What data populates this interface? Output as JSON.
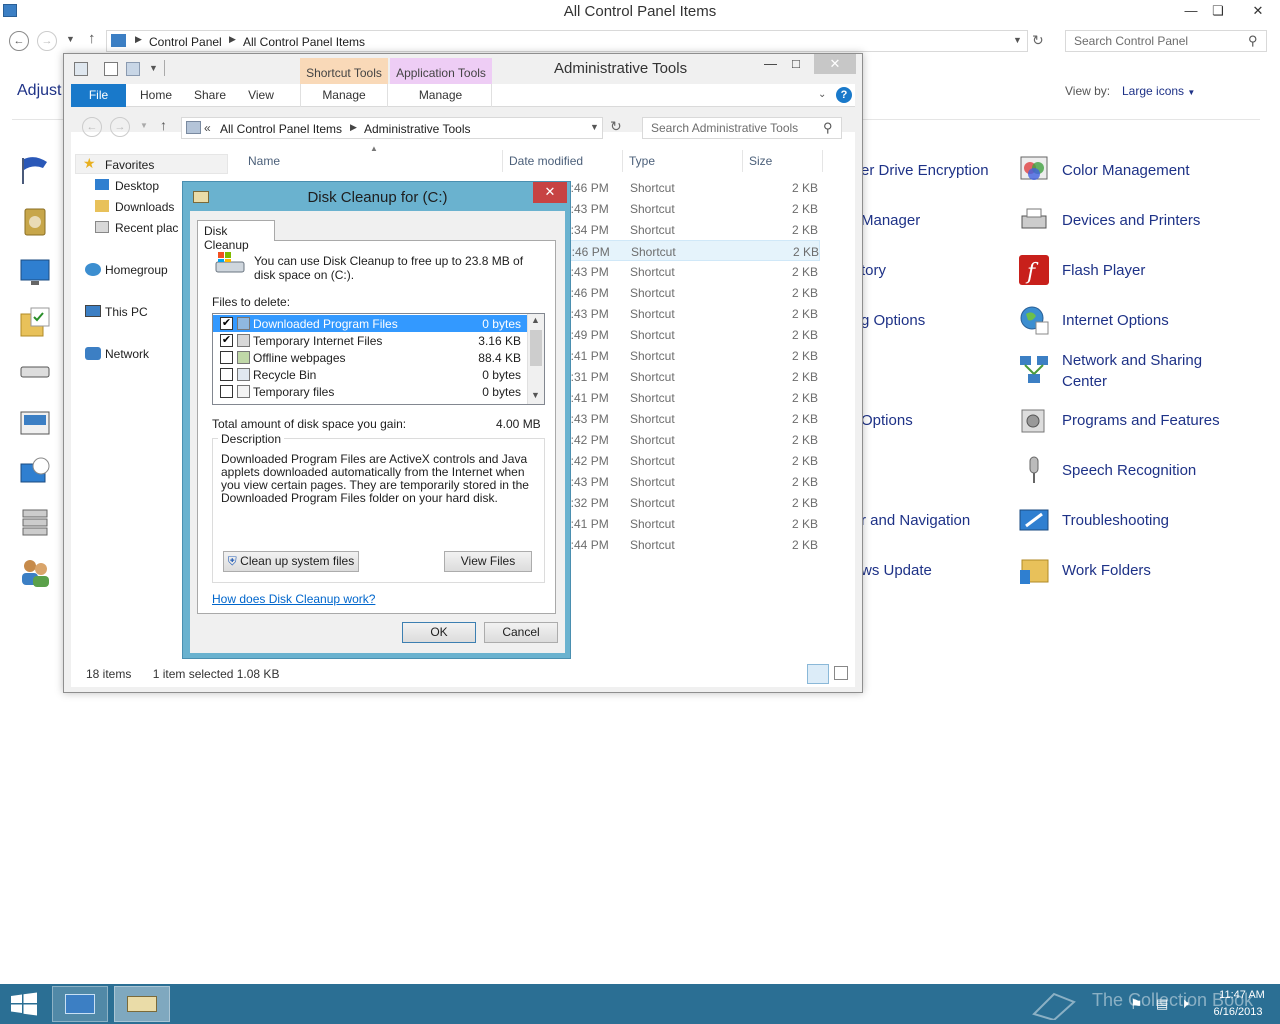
{
  "control_panel": {
    "window_title": "All Control Panel Items",
    "breadcrumb": [
      "Control Panel",
      "All Control Panel Items"
    ],
    "search_placeholder": "Search Control Panel",
    "heading_partial": "Adjust",
    "view_by_label": "View by:",
    "view_by_value": "Large icons",
    "items_middle": [
      "er Drive Encryption",
      "Manager",
      "tory",
      "g Options",
      "Options",
      "r and Navigation",
      "ws Update"
    ],
    "items_right": [
      "Color Management",
      "Devices and Printers",
      "Flash Player",
      "Internet Options",
      "Network and Sharing\nCenter",
      "Programs and Features",
      "Speech Recognition",
      "Troubleshooting",
      "Work Folders"
    ]
  },
  "admin_tools": {
    "window_title": "Administrative Tools",
    "context_tabs": [
      "Shortcut Tools",
      "Application Tools"
    ],
    "ribbon_tabs": [
      "File",
      "Home",
      "Share",
      "View",
      "Manage",
      "Manage"
    ],
    "breadcrumb": [
      "All Control Panel Items",
      "Administrative Tools"
    ],
    "search_placeholder": "Search Administrative Tools",
    "nav": {
      "favorites": "Favorites",
      "desktop": "Desktop",
      "downloads": "Downloads",
      "recent": "Recent plac",
      "homegroup": "Homegroup",
      "this_pc": "This PC",
      "network": "Network"
    },
    "columns": [
      "Name",
      "Date modified",
      "Type",
      "Size"
    ],
    "rows": [
      {
        "date": "2:46 PM",
        "type": "Shortcut",
        "size": "2 KB"
      },
      {
        "date": "2:43 PM",
        "type": "Shortcut",
        "size": "2 KB"
      },
      {
        "date": "2:34 PM",
        "type": "Shortcut",
        "size": "2 KB"
      },
      {
        "date": "2:46 PM",
        "type": "Shortcut",
        "size": "2 KB"
      },
      {
        "date": "2:43 PM",
        "type": "Shortcut",
        "size": "2 KB"
      },
      {
        "date": "2:46 PM",
        "type": "Shortcut",
        "size": "2 KB"
      },
      {
        "date": "2:43 PM",
        "type": "Shortcut",
        "size": "2 KB"
      },
      {
        "date": "2:49 PM",
        "type": "Shortcut",
        "size": "2 KB"
      },
      {
        "date": "2:41 PM",
        "type": "Shortcut",
        "size": "2 KB"
      },
      {
        "date": "2:31 PM",
        "type": "Shortcut",
        "size": "2 KB"
      },
      {
        "date": "2:41 PM",
        "type": "Shortcut",
        "size": "2 KB"
      },
      {
        "date": "2:43 PM",
        "type": "Shortcut",
        "size": "2 KB"
      },
      {
        "date": "2:42 PM",
        "type": "Shortcut",
        "size": "2 KB"
      },
      {
        "date": "2:42 PM",
        "type": "Shortcut",
        "size": "2 KB"
      },
      {
        "date": "2:43 PM",
        "type": "Shortcut",
        "size": "2 KB"
      },
      {
        "date": "2:32 PM",
        "type": "Shortcut",
        "size": "2 KB"
      },
      {
        "date": "2:41 PM",
        "type": "Shortcut",
        "size": "2 KB"
      },
      {
        "date": "2:44 PM",
        "type": "Shortcut",
        "size": "2 KB"
      }
    ],
    "status": {
      "count": "18 items",
      "selection": "1 item selected  1.08 KB"
    }
  },
  "disk_cleanup": {
    "title": "Disk Cleanup for  (C:)",
    "tab": "Disk Cleanup",
    "intro": "You can use Disk Cleanup to free up to 23.8 MB of disk space on  (C:).",
    "files_label": "Files to delete:",
    "files": [
      {
        "name": "Downloaded Program Files",
        "size": "0 bytes",
        "checked": true,
        "selected": true
      },
      {
        "name": "Temporary Internet Files",
        "size": "3.16 KB",
        "checked": true,
        "selected": false
      },
      {
        "name": "Offline webpages",
        "size": "88.4 KB",
        "checked": false,
        "selected": false
      },
      {
        "name": "Recycle Bin",
        "size": "0 bytes",
        "checked": false,
        "selected": false
      },
      {
        "name": "Temporary files",
        "size": "0 bytes",
        "checked": false,
        "selected": false
      }
    ],
    "total_label": "Total amount of disk space you gain:",
    "total_value": "4.00 MB",
    "description_label": "Description",
    "description": "Downloaded Program Files are ActiveX controls and Java applets downloaded automatically from the Internet when you view certain pages. They are temporarily stored in the Downloaded Program Files folder on your hard disk.",
    "cleanup_button": "Clean up system files",
    "view_files_button": "View Files",
    "help_link": "How does Disk Cleanup work?",
    "ok_button": "OK",
    "cancel_button": "Cancel"
  },
  "taskbar": {
    "time": "11:47 AM",
    "date": "6/16/2013",
    "watermark": "The Collection Book"
  }
}
